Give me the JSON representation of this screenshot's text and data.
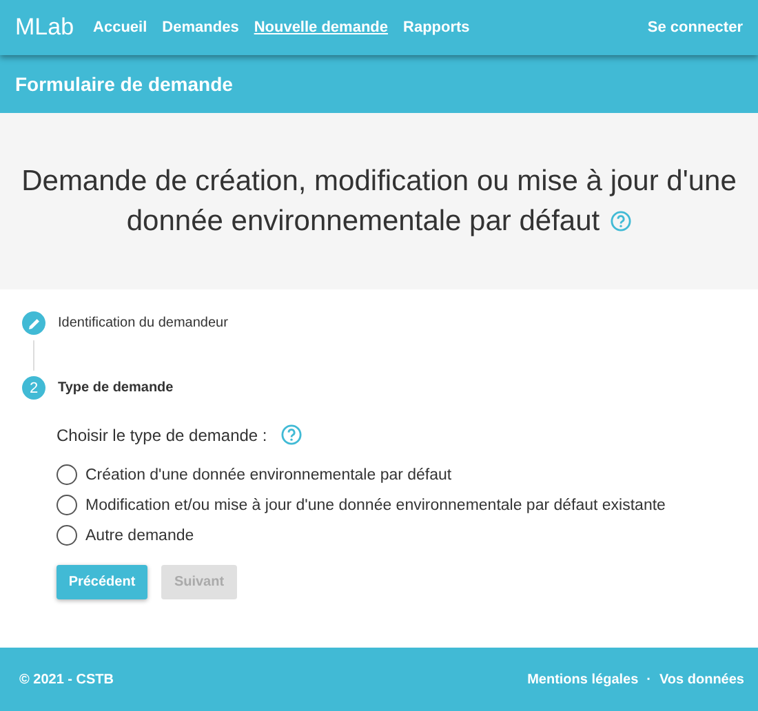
{
  "navbar": {
    "brand": "MLab",
    "links": [
      {
        "label": "Accueil",
        "selected": false
      },
      {
        "label": "Demandes",
        "selected": false
      },
      {
        "label": "Nouvelle demande",
        "selected": true
      },
      {
        "label": "Rapports",
        "selected": false
      }
    ],
    "login": "Se connecter"
  },
  "page_header": {
    "title": "Formulaire de demande"
  },
  "hero": {
    "title": "Demande de création, modification ou mise à jour d'une donnée environnementale par défaut"
  },
  "steps": [
    {
      "kind": "done",
      "label": "Identification du demandeur",
      "active": false
    },
    {
      "kind": "current",
      "number": "2",
      "label": "Type de demande",
      "active": true
    }
  ],
  "question": "Choisir le type de demande :",
  "options": [
    {
      "label": "Création d'une donnée environnementale par défaut",
      "selected": false
    },
    {
      "label": "Modification et/ou mise à jour d'une donnée environnementale par défaut existante",
      "selected": false
    },
    {
      "label": "Autre demande",
      "selected": false
    }
  ],
  "buttons": [
    {
      "label": "Précédent",
      "disabled": false
    },
    {
      "label": "Suivant",
      "disabled": true
    }
  ],
  "footer": {
    "copyright": "© 2021 - CSTB",
    "links": [
      "Mentions légales",
      "Vos données"
    ],
    "separator": "·"
  }
}
